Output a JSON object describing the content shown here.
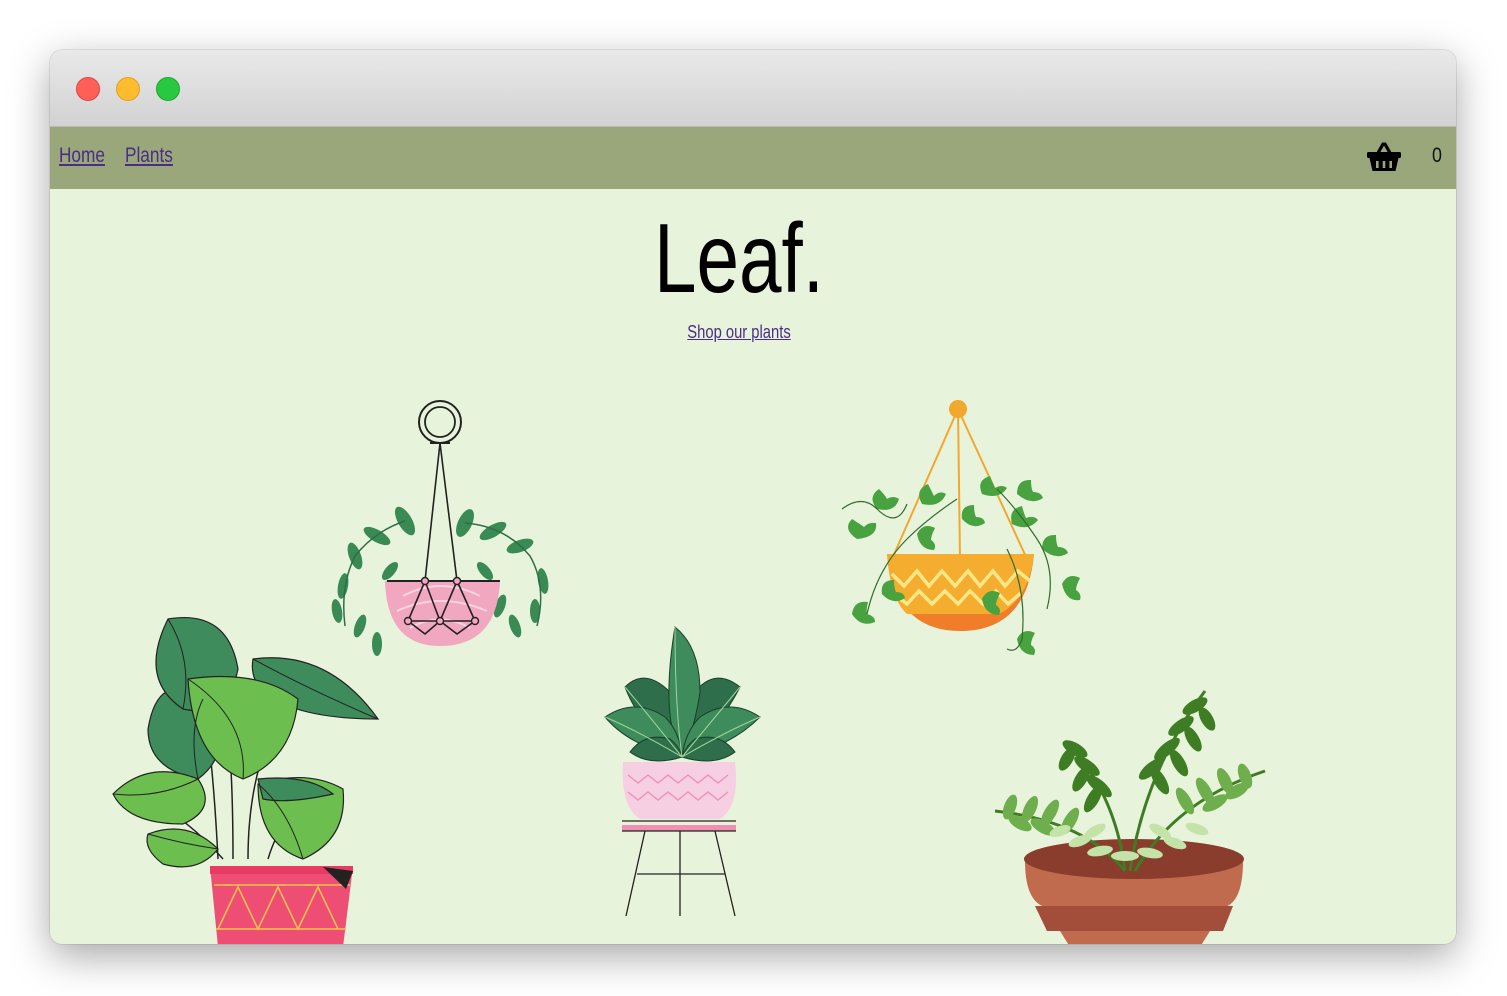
{
  "nav": {
    "links": [
      {
        "label": "Home"
      },
      {
        "label": "Plants"
      }
    ],
    "cart_icon": "basket-icon",
    "cart_count": "0"
  },
  "hero": {
    "title": "Leaf.",
    "cta_label": "Shop our plants"
  },
  "colors": {
    "page_background": "#e8f3db",
    "navbar": "#99a77b",
    "link": "#4a2d86"
  },
  "illustrations": [
    "hanging-pink-pot-plant",
    "hanging-yellow-basket-plant",
    "potted-monstera-red-pot",
    "potted-plant-on-stand",
    "potted-fern-terracotta"
  ]
}
